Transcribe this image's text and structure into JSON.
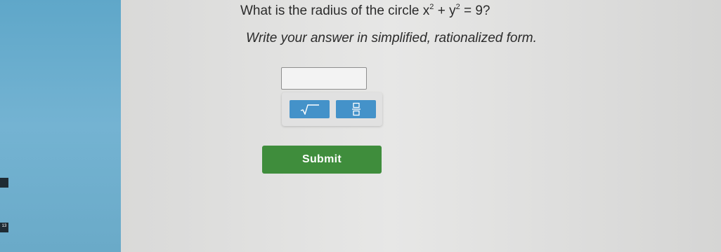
{
  "question": {
    "text": "What is the radius of the circle ",
    "x_var": "x",
    "y_var": "y",
    "exponent": "2",
    "plus": "+",
    "rhs": "= 9?"
  },
  "instructions": "Write your answer in simplified, rationalized form.",
  "answer": {
    "value": ""
  },
  "toolbar": {
    "sqrt_icon": "square-root-icon",
    "fraction_icon": "fraction-icon"
  },
  "submit_label": "Submit",
  "sidebar": {
    "tab_top": "",
    "tab_bottom": "13"
  },
  "colors": {
    "sidebar": "#6aaac8",
    "tool_button": "#4492c9",
    "submit": "#3f8d3c"
  }
}
